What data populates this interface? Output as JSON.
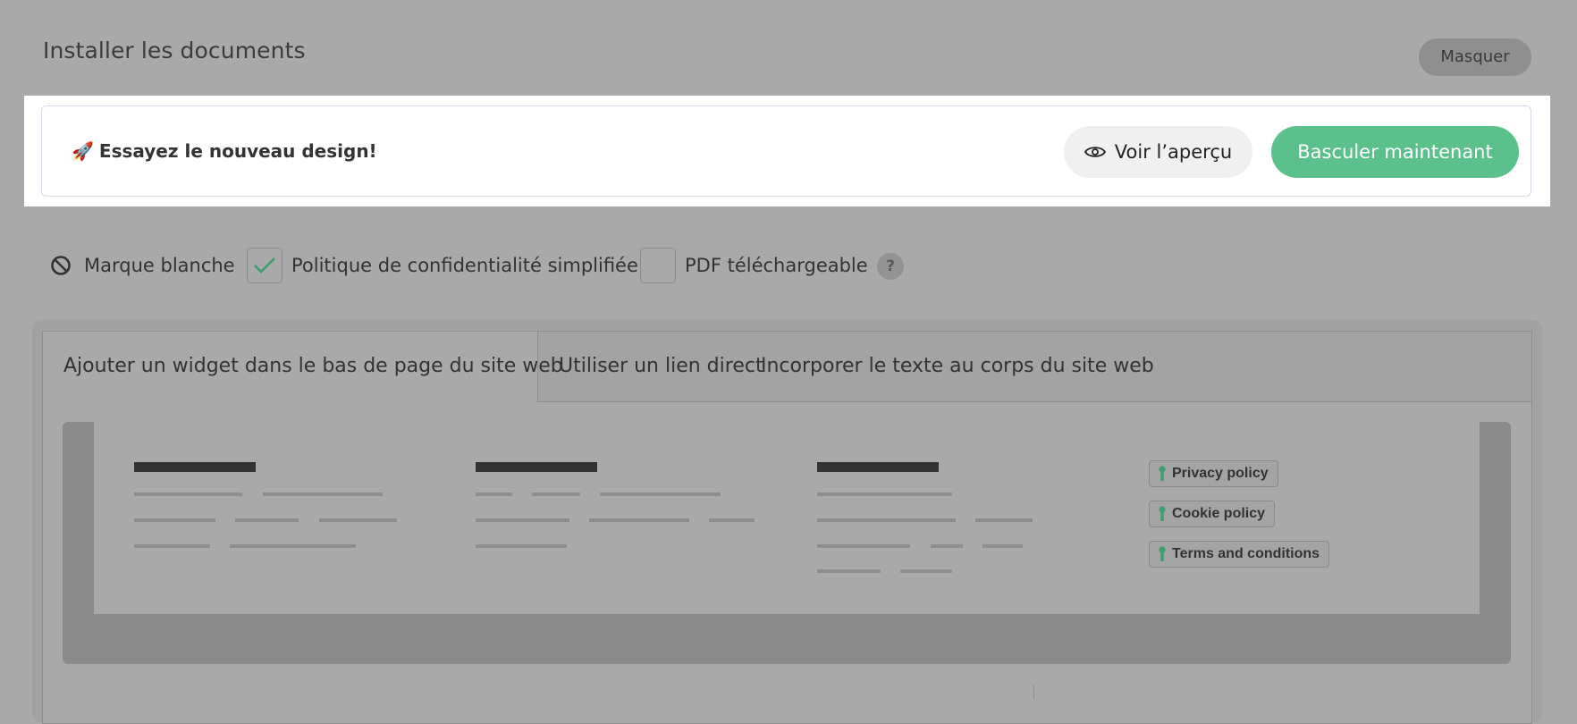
{
  "header": {
    "title": "Installer les documents",
    "hide_label": "Masquer"
  },
  "banner": {
    "emoji": "🚀",
    "text": "Essayez le nouveau design!",
    "preview_label": "Voir l’aperçu",
    "switch_label": "Basculer maintenant"
  },
  "options": {
    "white_label": "Marque blanche",
    "simplified_policy": "Politique de confidentialité simplifiée",
    "simplified_policy_checked": true,
    "pdf_download": "PDF téléchargeable",
    "pdf_download_checked": false,
    "help": "?"
  },
  "tabs": [
    {
      "label": "Ajouter un widget dans le bas de page du site web",
      "active": true
    },
    {
      "label": "Utiliser un lien direct",
      "active": false
    },
    {
      "label": "Incorporer le texte au corps du site web",
      "active": false
    }
  ],
  "footer_preview": {
    "links": [
      "Privacy policy",
      "Cookie policy",
      "Terms and conditions"
    ]
  },
  "colors": {
    "accent_green": "#5cc08d",
    "overlay_gray": "#a9a9a9"
  },
  "icons": [
    "rocket-icon",
    "eye-icon",
    "no-entry-icon",
    "check-icon",
    "help-icon",
    "key-icon"
  ]
}
